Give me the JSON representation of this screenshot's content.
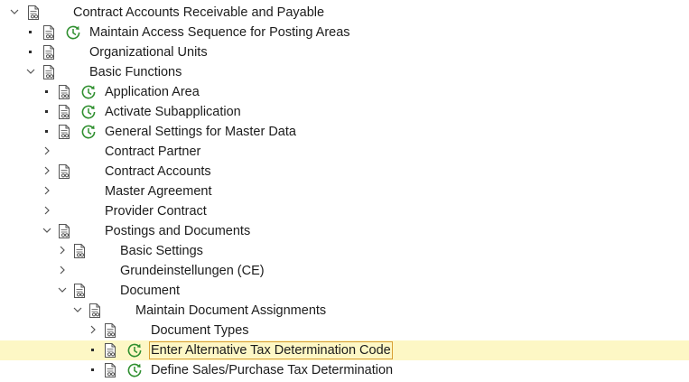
{
  "tree": {
    "rows": [
      {
        "label": "Contract Accounts Receivable and Payable"
      },
      {
        "label": "Maintain Access Sequence for Posting Areas"
      },
      {
        "label": "Organizational Units"
      },
      {
        "label": "Basic Functions"
      },
      {
        "label": "Application Area"
      },
      {
        "label": "Activate Subapplication"
      },
      {
        "label": "General Settings for Master Data"
      },
      {
        "label": "Contract Partner"
      },
      {
        "label": "Contract Accounts"
      },
      {
        "label": "Master Agreement"
      },
      {
        "label": "Provider Contract"
      },
      {
        "label": "Postings and Documents"
      },
      {
        "label": "Basic Settings"
      },
      {
        "label": "Grundeinstellungen (CE)"
      },
      {
        "label": "Document"
      },
      {
        "label": "Maintain Document Assignments"
      },
      {
        "label": "Document Types"
      },
      {
        "label": "Enter Alternative Tax Determination Code"
      },
      {
        "label": "Define Sales/Purchase Tax Determination"
      }
    ]
  },
  "icons": {
    "toggle_expanded": "chevron-down-icon",
    "toggle_collapsed": "chevron-right-icon",
    "leaf": "bullet-icon",
    "documentation": "documentation-icon",
    "execute": "execute-clock-icon"
  },
  "colors": {
    "selection": "#fdf7c5",
    "selection_border": "#d9a036",
    "execute_icon": "#2f8f2f"
  }
}
